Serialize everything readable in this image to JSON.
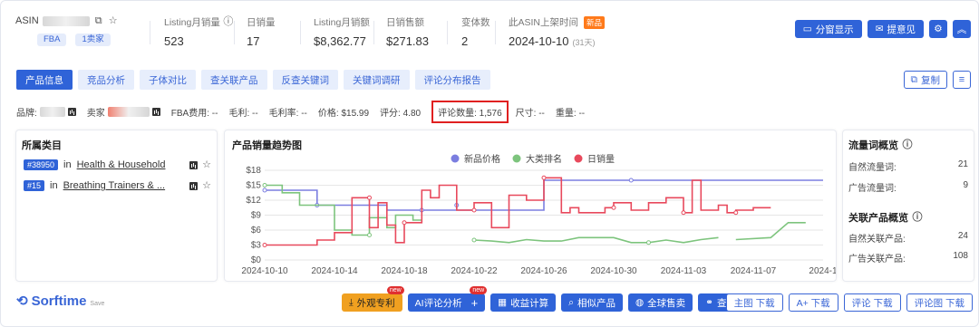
{
  "header": {
    "asin_label": "ASIN",
    "badges": [
      "FBA",
      "1卖家"
    ],
    "stats": [
      {
        "label": "Listing月销量",
        "value": "523",
        "has_help": true
      },
      {
        "label": "日销量",
        "value": "17"
      },
      {
        "label": "Listing月销额",
        "value": "$8,362.77"
      },
      {
        "label": "日销售额",
        "value": "$271.83"
      },
      {
        "label": "变体数",
        "value": "2"
      },
      {
        "label": "此ASIN上架时间",
        "value": "2024-10-10",
        "sub": "(31天)",
        "new_tag": "新品"
      }
    ],
    "buttons": {
      "split": "分窗显示",
      "feedback": "提意见"
    }
  },
  "tabs": [
    "产品信息",
    "竞品分析",
    "子体对比",
    "查关联产品",
    "反查关键词",
    "关键词调研",
    "评论分布报告"
  ],
  "copy_label": "复制",
  "info": {
    "brand_label": "品牌:",
    "seller_label": "卖家",
    "fba_fee": "FBA费用: --",
    "gross_profit": "毛利: --",
    "gross_margin": "毛利率: --",
    "price": "价格: $15.99",
    "rating": "评分: 4.80",
    "review_count": "评论数量: 1,576",
    "size": "尺寸: --",
    "weight": "重量: --"
  },
  "category": {
    "title": "所属类目",
    "items": [
      {
        "rank": "#38950",
        "in": "in",
        "name": "Health & Household"
      },
      {
        "rank": "#15",
        "in": "in",
        "name": "Breathing Trainers & ..."
      }
    ]
  },
  "traffic": {
    "title": "流量词概览",
    "rows": [
      {
        "label": "自然流量词:",
        "value": "21"
      },
      {
        "label": "广告流量词:",
        "value": "9"
      }
    ],
    "related_title": "关联产品概览",
    "related_rows": [
      {
        "label": "自然关联产品:",
        "value": "24"
      },
      {
        "label": "广告关联产品:",
        "value": "108"
      }
    ]
  },
  "chart_data": {
    "type": "line",
    "title": "产品销量趋势图",
    "legend": [
      "新品价格",
      "大类排名",
      "日销量"
    ],
    "legend_position": "top-center",
    "colors": {
      "price": "#7b7ee0",
      "rank": "#7dc47d",
      "sales": "#e8495c"
    },
    "x_ticks": [
      "2024-10-10",
      "2024-10-14",
      "2024-10-18",
      "2024-10-22",
      "2024-10-26",
      "2024-10-30",
      "2024-11-03",
      "2024-11-07",
      "2024-1"
    ],
    "y_ticks": [
      "$0",
      "$3",
      "$6",
      "$9",
      "$12",
      "$15",
      "$18"
    ],
    "ylim": [
      0,
      18
    ],
    "xlim": [
      0,
      32
    ],
    "grid": true,
    "series": [
      {
        "name": "新品价格",
        "points": [
          [
            0,
            14
          ],
          [
            3,
            14
          ],
          [
            3,
            14
          ],
          [
            3,
            14
          ],
          [
            3,
            11
          ],
          [
            3,
            11
          ],
          [
            3,
            11
          ],
          [
            7,
            11
          ],
          [
            7,
            11
          ],
          [
            7,
            10
          ],
          [
            9,
            10
          ],
          [
            9,
            10
          ],
          [
            9,
            10
          ],
          [
            11,
            10
          ],
          [
            11,
            11
          ],
          [
            11,
            11
          ],
          [
            11,
            10
          ],
          [
            16,
            10
          ],
          [
            16,
            16
          ],
          [
            17,
            16
          ],
          [
            21,
            16
          ],
          [
            32,
            16
          ]
        ]
      },
      {
        "name": "大类排名",
        "points": [
          [
            0,
            15
          ],
          [
            1,
            15
          ],
          [
            1,
            13.5
          ],
          [
            2,
            13.5
          ],
          [
            2,
            11
          ],
          [
            4,
            11
          ],
          [
            4,
            6
          ],
          [
            5,
            6
          ],
          [
            5,
            5
          ],
          [
            6,
            5
          ],
          [
            6,
            8.5
          ],
          [
            7,
            8.5
          ],
          [
            7,
            6.5
          ],
          [
            7.5,
            6.5
          ],
          [
            7.5,
            9
          ],
          [
            8.5,
            9
          ],
          [
            8.5,
            8
          ],
          [
            9,
            8
          ],
          [
            null,
            null
          ],
          [
            12,
            4
          ],
          [
            13,
            3.8
          ],
          [
            14,
            3.5
          ],
          [
            15,
            4.1
          ],
          [
            16,
            3.8
          ],
          [
            17,
            3.8
          ],
          [
            18,
            4.5
          ],
          [
            20,
            4.5
          ],
          [
            21,
            3.5
          ],
          [
            22,
            3.5
          ],
          [
            23,
            4
          ],
          [
            24,
            3.5
          ],
          [
            25,
            4.1
          ],
          [
            26,
            4.5
          ],
          [
            null,
            null
          ],
          [
            27,
            4.1
          ],
          [
            29,
            4.5
          ],
          [
            30,
            7.5
          ],
          [
            31,
            7.5
          ]
        ]
      },
      {
        "name": "日销量",
        "points": [
          [
            0,
            3
          ],
          [
            3,
            3
          ],
          [
            3,
            3.5
          ],
          [
            3,
            3.5
          ],
          [
            3,
            4
          ],
          [
            4,
            4
          ],
          [
            4,
            5.5
          ],
          [
            5,
            5.5
          ],
          [
            5,
            12.5
          ],
          [
            6,
            12.5
          ],
          [
            6,
            6.5
          ],
          [
            6.5,
            6.5
          ],
          [
            6.5,
            11.5
          ],
          [
            7,
            11.5
          ],
          [
            7,
            7
          ],
          [
            7.5,
            7
          ],
          [
            7.5,
            3.5
          ],
          [
            8,
            3.5
          ],
          [
            8,
            7.5
          ],
          [
            9,
            7.5
          ],
          [
            9,
            14
          ],
          [
            9.5,
            14
          ],
          [
            9.5,
            12.5
          ],
          [
            10,
            12.5
          ],
          [
            10,
            15
          ],
          [
            11,
            15
          ],
          [
            11,
            10
          ],
          [
            12,
            10
          ],
          [
            12,
            11.5
          ],
          [
            13,
            11.5
          ],
          [
            13,
            6.5
          ],
          [
            14,
            6.5
          ],
          [
            14,
            13
          ],
          [
            15,
            13
          ],
          [
            15,
            12
          ],
          [
            16,
            12
          ],
          [
            16,
            16.5
          ],
          [
            17,
            16.5
          ],
          [
            17,
            9.5
          ],
          [
            17.5,
            9.5
          ],
          [
            17.5,
            10.5
          ],
          [
            18,
            10.5
          ],
          [
            18,
            9.5
          ],
          [
            19.5,
            9.5
          ],
          [
            19.5,
            10.5
          ],
          [
            20,
            10.5
          ],
          [
            20,
            11.5
          ],
          [
            21,
            11.5
          ],
          [
            21,
            10
          ],
          [
            22,
            10
          ],
          [
            22,
            11.5
          ],
          [
            23,
            11.5
          ],
          [
            23,
            12.5
          ],
          [
            24,
            12.5
          ],
          [
            24,
            9.5
          ],
          [
            24.5,
            9.5
          ],
          [
            24.5,
            16
          ],
          [
            25,
            16
          ],
          [
            25,
            10
          ],
          [
            26,
            10
          ],
          [
            26,
            11
          ],
          [
            26.5,
            11
          ],
          [
            26.5,
            9.5
          ],
          [
            27,
            9.5
          ],
          [
            27,
            10
          ],
          [
            28,
            10
          ],
          [
            28,
            10.5
          ],
          [
            29,
            10.5
          ]
        ]
      }
    ]
  },
  "footer": {
    "brand": "Sorftime",
    "brand_sub": "Save",
    "actions": [
      {
        "label": "外观专利",
        "new": "new",
        "style": "orange",
        "icon": "download-icon"
      },
      {
        "label": "AI评论分析",
        "new": "new",
        "style": "blue",
        "icon": "plus-icon",
        "trailing": "+"
      },
      {
        "label": "收益计算",
        "style": "blue",
        "icon": "calculator-icon"
      },
      {
        "label": "相似产品",
        "style": "blue",
        "icon": "search-icon"
      },
      {
        "label": "全球售卖",
        "style": "blue",
        "icon": "globe-icon"
      },
      {
        "label": "查供应链",
        "style": "blue",
        "icon": "link-icon"
      }
    ],
    "downloads": [
      "主图 下载",
      "A+ 下载",
      "评论 下载",
      "评论图 下载"
    ]
  }
}
